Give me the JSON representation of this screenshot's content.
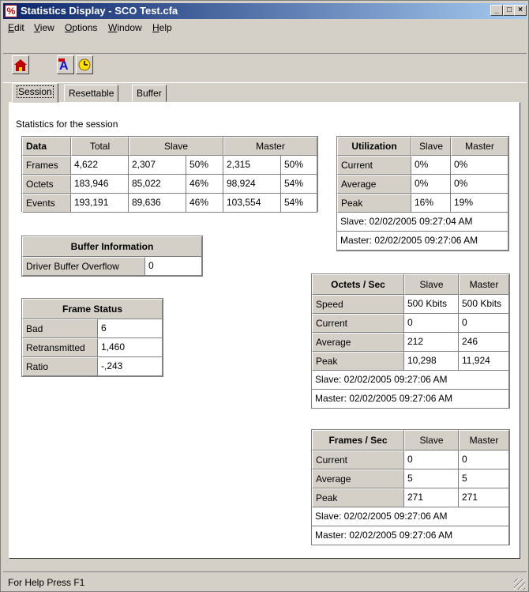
{
  "window": {
    "title": "Statistics Display - SCO Test.cfa"
  },
  "menu": [
    {
      "label": "Edit",
      "u": "E"
    },
    {
      "label": "View",
      "u": "V"
    },
    {
      "label": "Options",
      "u": "O"
    },
    {
      "label": "Window",
      "u": "W"
    },
    {
      "label": "Help",
      "u": "H"
    }
  ],
  "toolbar": {
    "icons": [
      "home-icon",
      "font-icon",
      "clock-icon"
    ]
  },
  "tabs": [
    "Session",
    "Resettable",
    "Buffer"
  ],
  "caption": "Statistics for the session",
  "data_table": {
    "headers": [
      "Data",
      "Total",
      "Slave",
      "Master"
    ],
    "rows": [
      [
        "Frames",
        "4,622",
        "2,307",
        "50%",
        "2,315",
        "50%"
      ],
      [
        "Octets",
        "183,946",
        "85,022",
        "46%",
        "98,924",
        "54%"
      ],
      [
        "Events",
        "193,191",
        "89,636",
        "46%",
        "103,554",
        "54%"
      ]
    ]
  },
  "utilization": {
    "headers": [
      "Utilization",
      "Slave",
      "Master"
    ],
    "rows": [
      [
        "Current",
        "0%",
        "0%"
      ],
      [
        "Average",
        "0%",
        "0%"
      ],
      [
        "Peak",
        "16%",
        "19%"
      ]
    ],
    "slave_ts": "Slave: 02/02/2005 09:27:04 AM",
    "master_ts": "Master: 02/02/2005 09:27:06 AM"
  },
  "buffer_info": {
    "title": "Buffer Information",
    "label": "Driver Buffer Overflow",
    "value": "0"
  },
  "frame_status": {
    "title": "Frame Status",
    "rows": [
      [
        "Bad",
        "6"
      ],
      [
        "Retransmitted",
        "1,460"
      ],
      [
        "Ratio",
        "-,243"
      ]
    ]
  },
  "octets_sec": {
    "headers": [
      "Octets / Sec",
      "Slave",
      "Master"
    ],
    "rows": [
      [
        "Speed",
        "500 Kbits",
        "500 Kbits"
      ],
      [
        "Current",
        "0",
        "0"
      ],
      [
        "Average",
        "212",
        "246"
      ],
      [
        "Peak",
        "10,298",
        "11,924"
      ]
    ],
    "slave_ts": "Slave: 02/02/2005 09:27:06 AM",
    "master_ts": "Master: 02/02/2005 09:27:06 AM"
  },
  "frames_sec": {
    "headers": [
      "Frames / Sec",
      "Slave",
      "Master"
    ],
    "rows": [
      [
        "Current",
        "0",
        "0"
      ],
      [
        "Average",
        "5",
        "5"
      ],
      [
        "Peak",
        "271",
        "271"
      ]
    ],
    "slave_ts": "Slave: 02/02/2005 09:27:06 AM",
    "master_ts": "Master: 02/02/2005 09:27:06 AM"
  },
  "status": {
    "text": "For Help Press F1"
  }
}
